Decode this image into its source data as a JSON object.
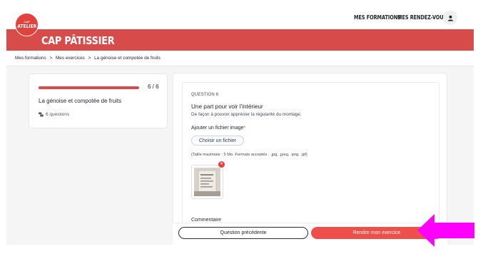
{
  "header": {
    "logo_small": "CAP",
    "logo_text": "ATELIER",
    "nav": [
      "MES FORMATIONS",
      "MES RENDEZ-VOUS"
    ],
    "banner_title": "CAP PÂTISSIER"
  },
  "breadcrumb": {
    "items": [
      "Mes formations",
      "Mes exercices",
      "La génoise et compotée de fruits"
    ],
    "separator": ">"
  },
  "sidebar": {
    "progress_text": "6 / 6",
    "progress_fraction": 1.0,
    "title": "La génoise et compotée de fruits",
    "questions_count": "6 questions"
  },
  "question": {
    "label": "QUESTION 6",
    "title": "Une part pour voir l'intérieur",
    "description": "De façon à pouvoir apprécier la régularité du montage.",
    "file_label": "Ajouter un fichier image",
    "required_mark": "*",
    "file_button": "Choisir un fichier",
    "file_hint": "(Taille maximale : 5 Mo. Formats acceptés : .jpg, .jpeg, .png, .gif)",
    "remove_icon": "×",
    "comment_label": "Commentaire"
  },
  "footer": {
    "prev_label": "Question précédente",
    "submit_label": "Rendre mon exercice"
  },
  "colors": {
    "brand_red": "#d84b4b",
    "button_red": "#ef4f4a",
    "annotation_arrow": "#ff00ff"
  },
  "icons": {
    "user": "user-icon",
    "questions": "list-icon",
    "remove": "close-icon",
    "annotation": "arrow-left-icon"
  }
}
